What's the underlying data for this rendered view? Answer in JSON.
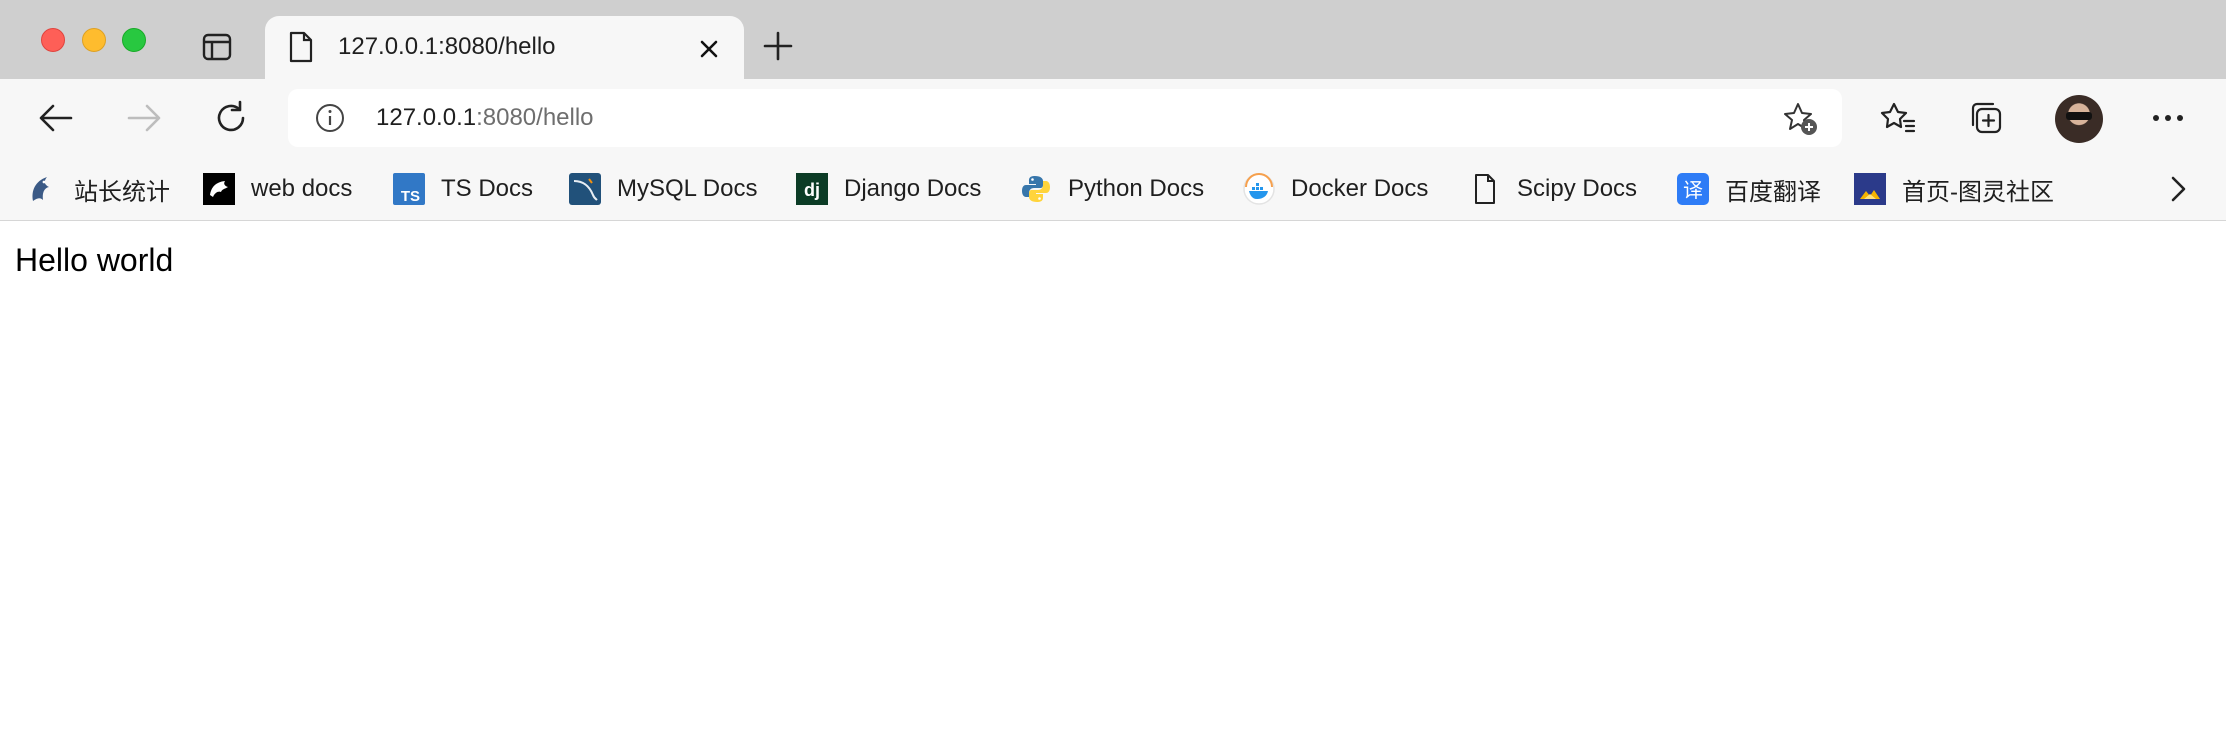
{
  "tab": {
    "title": "127.0.0.1:8080/hello"
  },
  "address": {
    "host": "127.0.0.1",
    "rest": ":8080/hello"
  },
  "bookmarks": [
    {
      "label": "站长统计",
      "icon": "dolphin-icon"
    },
    {
      "label": "web docs",
      "icon": "mdn-icon"
    },
    {
      "label": "TS Docs",
      "icon": "typescript-icon"
    },
    {
      "label": "MySQL Docs",
      "icon": "mysql-icon"
    },
    {
      "label": "Django Docs",
      "icon": "django-icon"
    },
    {
      "label": "Python Docs",
      "icon": "python-icon"
    },
    {
      "label": "Docker Docs",
      "icon": "docker-icon"
    },
    {
      "label": "Scipy Docs",
      "icon": "page-icon"
    },
    {
      "label": "百度翻译",
      "icon": "translate-icon"
    },
    {
      "label": "首页-图灵社区",
      "icon": "turing-icon"
    }
  ],
  "icons": {
    "typescript": "TS",
    "django": "dj",
    "translate": "译"
  },
  "page": {
    "text": "Hello world"
  },
  "colors": {
    "tabbar": "#cfcfcf",
    "toolbar": "#f7f7f7",
    "typescript": "#3178c6",
    "translate": "#2e7cf6",
    "django": "#0c3c26"
  }
}
